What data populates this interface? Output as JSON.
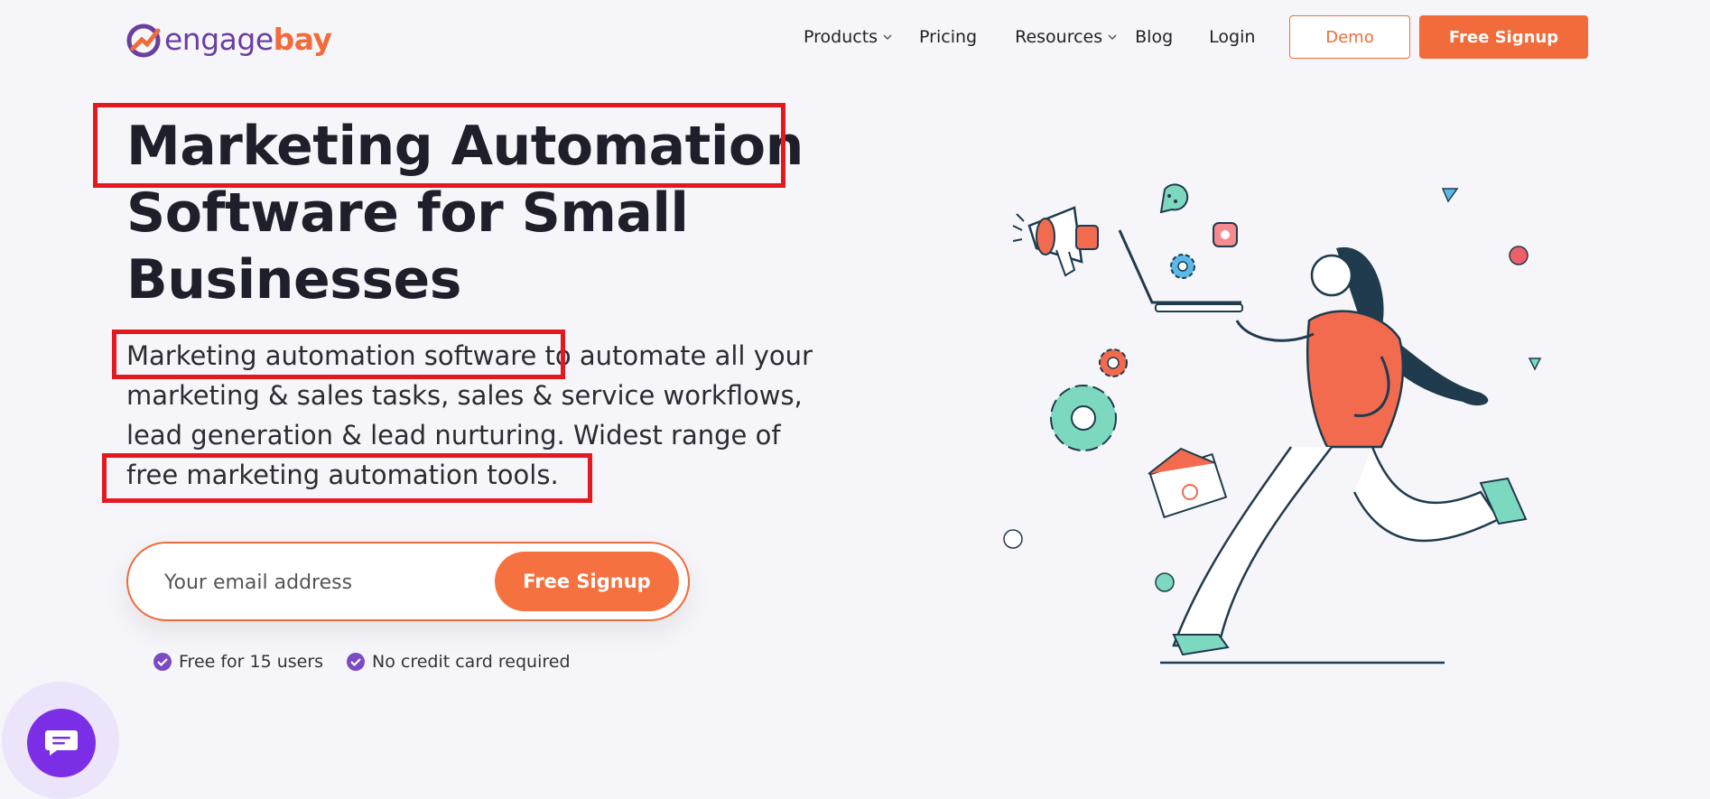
{
  "header": {
    "logo_part1": "engage",
    "logo_part2": "bay",
    "nav": [
      {
        "label": "Products",
        "has_dropdown": true
      },
      {
        "label": "Pricing",
        "has_dropdown": false
      },
      {
        "label": "Resources",
        "has_dropdown": true
      },
      {
        "label": "Blog",
        "has_dropdown": false
      },
      {
        "label": "Login",
        "has_dropdown": false
      }
    ],
    "demo_label": "Demo",
    "signup_label": "Free Signup"
  },
  "hero": {
    "title_lines": [
      "Marketing Automation",
      "Software for Small",
      "Businesses"
    ],
    "description_lines": [
      "Marketing automation software  to automate all your",
      "marketing & sales tasks, sales & service workflows,",
      "lead generation & lead nurturing. Widest range of",
      "free marketing automation tools."
    ]
  },
  "signup_form": {
    "email_placeholder": "Your email address",
    "button_label": "Free Signup"
  },
  "perks": [
    "Free for 15 users",
    "No credit card required"
  ],
  "colors": {
    "brand_purple": "#6b3fa0",
    "brand_orange": "#f26b3a",
    "highlight_red": "#e3191f",
    "chat_purple": "#7c2ee6"
  },
  "icons": {
    "chat": "chat-bubble-icon",
    "check": "check-circle-icon",
    "dropdown": "chevron-down-icon"
  }
}
